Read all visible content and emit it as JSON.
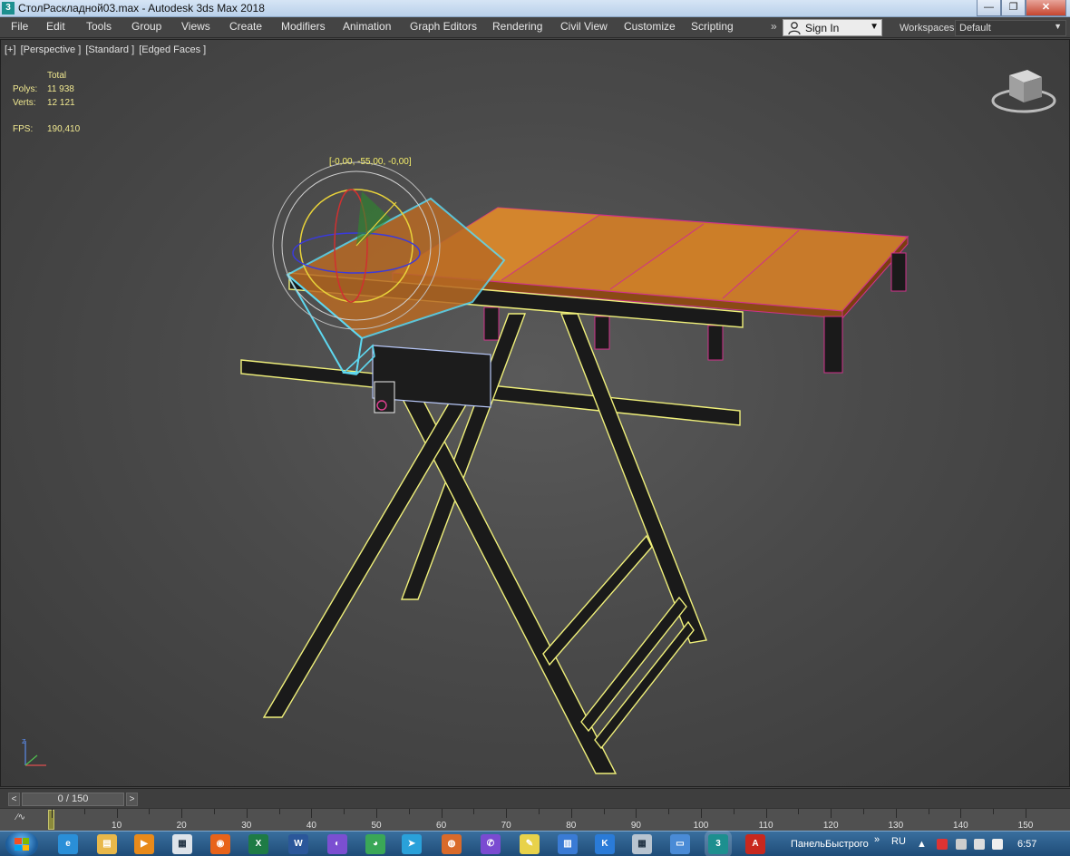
{
  "window": {
    "title": "СтолРаскладной03.max - Autodesk 3ds Max 2018",
    "app_icon_glyph": "3",
    "controls": {
      "minimize": "—",
      "maximize": "❐",
      "close": "✕"
    }
  },
  "menu": {
    "items": [
      "File",
      "Edit",
      "Tools",
      "Group",
      "Views",
      "Create",
      "Modifiers",
      "Animation",
      "Graph Editors",
      "Rendering",
      "Civil View",
      "Customize",
      "Scripting"
    ],
    "overflow": "»",
    "sign_in": "Sign In",
    "workspaces_label": "Workspaces:",
    "workspace_value": "Default"
  },
  "viewport": {
    "label_parts": [
      "[+]",
      "[Perspective ]",
      "[Standard ]",
      "[Edged Faces ]"
    ],
    "stats": {
      "total_label": "Total",
      "polys_label": "Polys:",
      "polys_value": "11 938",
      "verts_label": "Verts:",
      "verts_value": "12 121",
      "fps_label": "FPS:",
      "fps_value": "190,410"
    },
    "transform_readout": "[-0,00, -55,00, -0,00]",
    "axis_label": "z"
  },
  "timeline": {
    "slider_text": "0 / 150",
    "prev": "<",
    "next": ">",
    "track_icon": "∕∿",
    "tick_labels": [
      "10",
      "20",
      "30",
      "40",
      "50",
      "60",
      "70",
      "80",
      "90",
      "100",
      "110",
      "120",
      "130",
      "140",
      "150"
    ]
  },
  "taskbar": {
    "apps": [
      {
        "name": "ie",
        "glyph": "e",
        "color": "#2a8fd8"
      },
      {
        "name": "explorer",
        "glyph": "▤",
        "color": "#e8b84a"
      },
      {
        "name": "media-player",
        "glyph": "▶",
        "color": "#e88a1a"
      },
      {
        "name": "notepad",
        "glyph": "▦",
        "color": "#dde3ea"
      },
      {
        "name": "firefox",
        "glyph": "◉",
        "color": "#e8631a"
      },
      {
        "name": "excel",
        "glyph": "X",
        "color": "#1e7b45"
      },
      {
        "name": "word",
        "glyph": "W",
        "color": "#2b579a"
      },
      {
        "name": "app-purple",
        "glyph": "◐",
        "color": "#7b4fd1"
      },
      {
        "name": "chrome",
        "glyph": "◕",
        "color": "#3aa757"
      },
      {
        "name": "telegram",
        "glyph": "➤",
        "color": "#2aa1da"
      },
      {
        "name": "app-orange",
        "glyph": "◍",
        "color": "#d96a2a"
      },
      {
        "name": "viber",
        "glyph": "✆",
        "color": "#7a4bd1"
      },
      {
        "name": "sticky",
        "glyph": "✎",
        "color": "#e8d24a"
      },
      {
        "name": "calendar",
        "glyph": "▥",
        "color": "#3a7bd5"
      },
      {
        "name": "app-k",
        "glyph": "K",
        "color": "#2a7bd8"
      },
      {
        "name": "calculator",
        "glyph": "▦",
        "color": "#b8c4d0"
      },
      {
        "name": "app-blue",
        "glyph": "▭",
        "color": "#4a8bd6"
      },
      {
        "name": "3dsmax",
        "glyph": "3",
        "color": "#1d8f8f"
      },
      {
        "name": "autocad",
        "glyph": "A",
        "color": "#c8281e"
      }
    ],
    "quick_panel_label": "ПанельБыстрого",
    "overflow": "»",
    "language": "RU",
    "clock": "6:57"
  },
  "colors": {
    "viewport_bg": "#4a4a4a",
    "wire_yellow": "#f0f07a",
    "select_cyan": "#5ed8f0",
    "table_edge": "#d0308a",
    "wood": "#c87828",
    "stats_text": "#f0e890"
  }
}
